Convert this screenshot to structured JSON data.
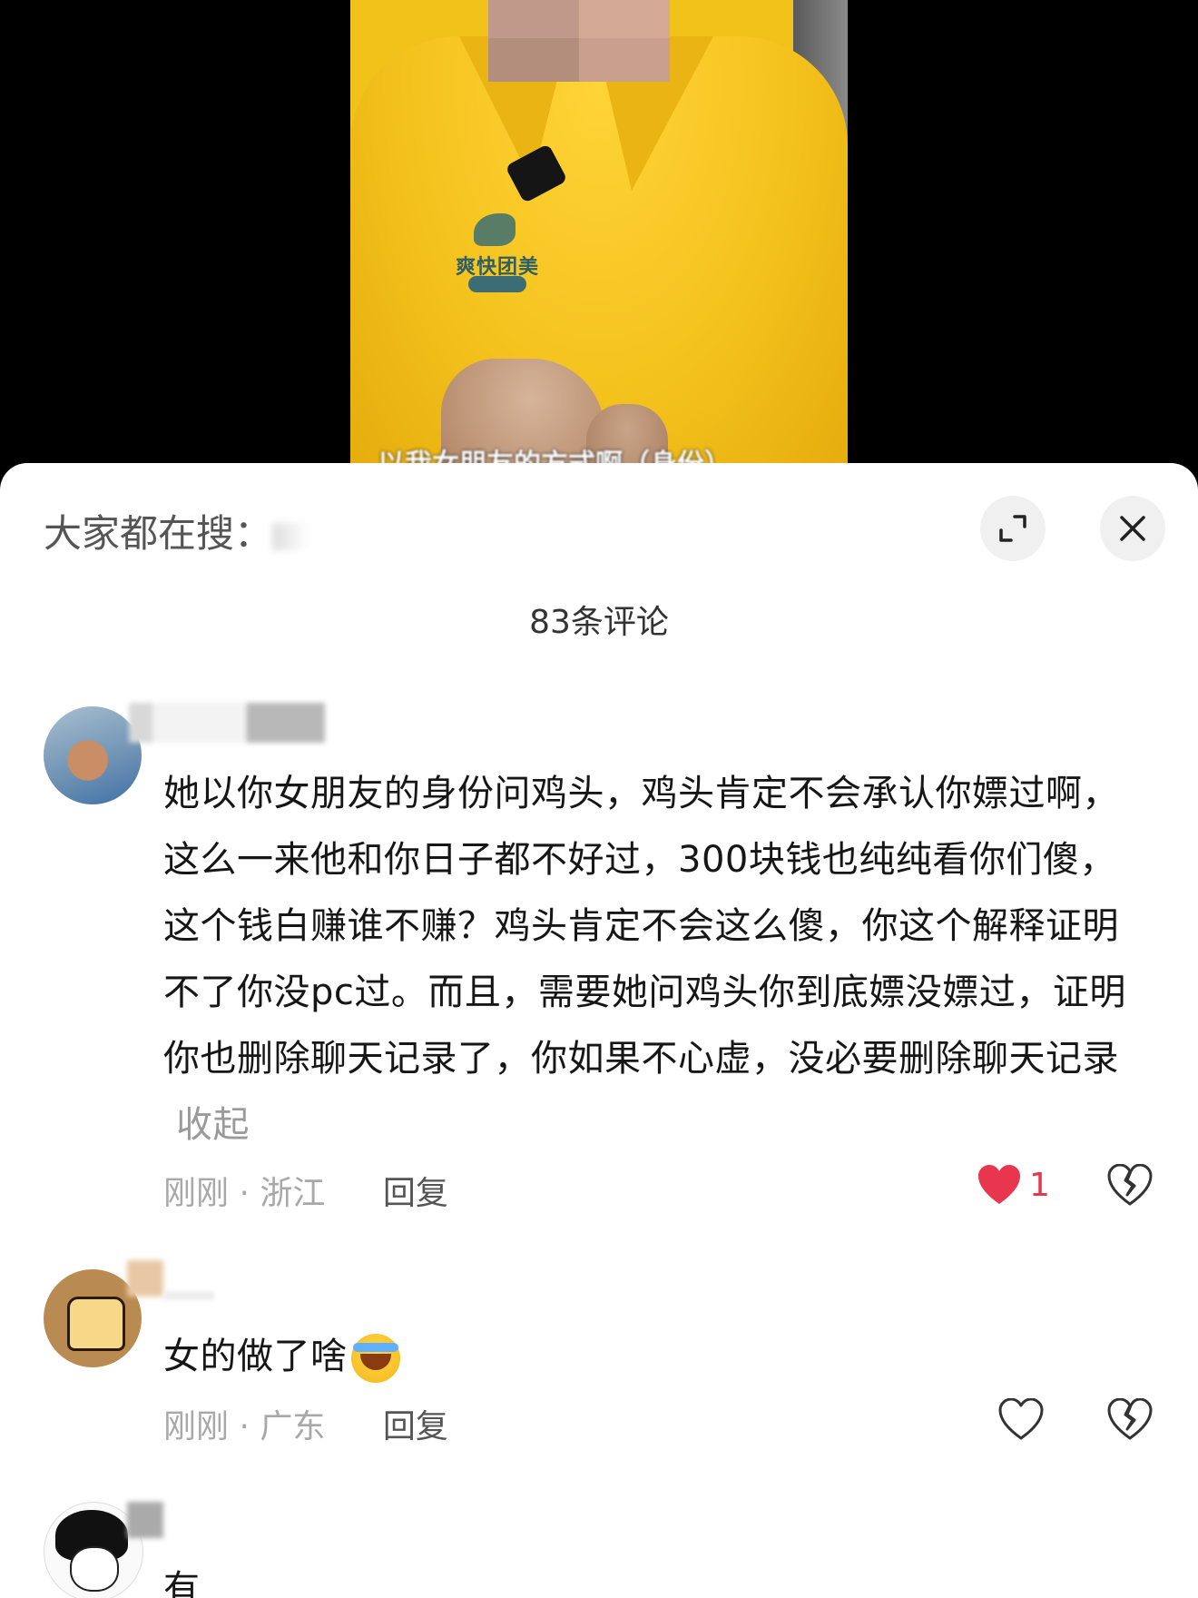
{
  "video": {
    "caption": "以我女朋友的方式啊（身份）",
    "shirt_logo": "爽快团美"
  },
  "panel": {
    "search_hint_label": "大家都在搜：",
    "comment_count": "83条评论"
  },
  "comments": [
    {
      "text": "她以你女朋友的身份问鸡头，鸡头肯定不会承认你嫖过啊，这么一来他和你日子都不好过，300块钱也纯纯看你们傻，这个钱白赚谁不赚？鸡头肯定不会这么傻，你这个解释证明不了你没pc过。而且，需要她问鸡头你到底嫖没嫖过，证明你也删除聊天记录了，你如果不心虚，没必要删除聊天记录",
      "collapse_label": "收起",
      "time": "刚刚",
      "location": "浙江",
      "reply_label": "回复",
      "like_count": "1",
      "liked": true
    },
    {
      "text": "女的做了啥",
      "time": "刚刚",
      "location": "广东",
      "reply_label": "回复",
      "liked": false
    },
    {
      "text": "有"
    }
  ],
  "colors": {
    "like_red": "#e8364e",
    "meta_gray": "#a8a8a8",
    "sheet_bg": "#ffffff"
  },
  "icons": {
    "expand": "expand-icon",
    "close": "close-icon",
    "like": "heart-icon",
    "dislike": "broken-heart-icon"
  }
}
